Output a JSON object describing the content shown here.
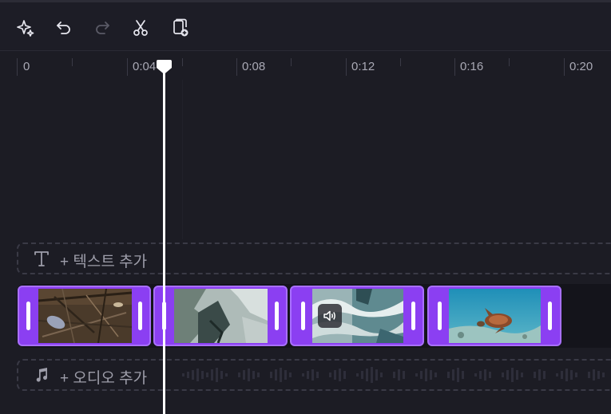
{
  "toolbar": {
    "buttons": [
      {
        "name": "magic-sparkle-icon"
      },
      {
        "name": "undo-icon"
      },
      {
        "name": "redo-icon"
      },
      {
        "name": "scissors-icon"
      },
      {
        "name": "duplicate-add-icon"
      }
    ]
  },
  "ruler": {
    "labels": [
      "0",
      "0:04",
      "0:08",
      "0:12",
      "0:16",
      "0:20"
    ]
  },
  "playhead": {
    "time": "0:04"
  },
  "text_lane": {
    "label": "+ 텍스트 추가",
    "icon": "text-T-icon"
  },
  "audio_lane": {
    "label": "+ 오디오 추가",
    "icon": "music-note-icon"
  },
  "clips": [
    {
      "subject": "driftwood-debris"
    },
    {
      "subject": "rocky-ice"
    },
    {
      "subject": "ocean-waves"
    },
    {
      "subject": "sea-turtle"
    }
  ],
  "colors": {
    "clip_accent": "#8b3ff2",
    "background": "#1c1c24"
  }
}
